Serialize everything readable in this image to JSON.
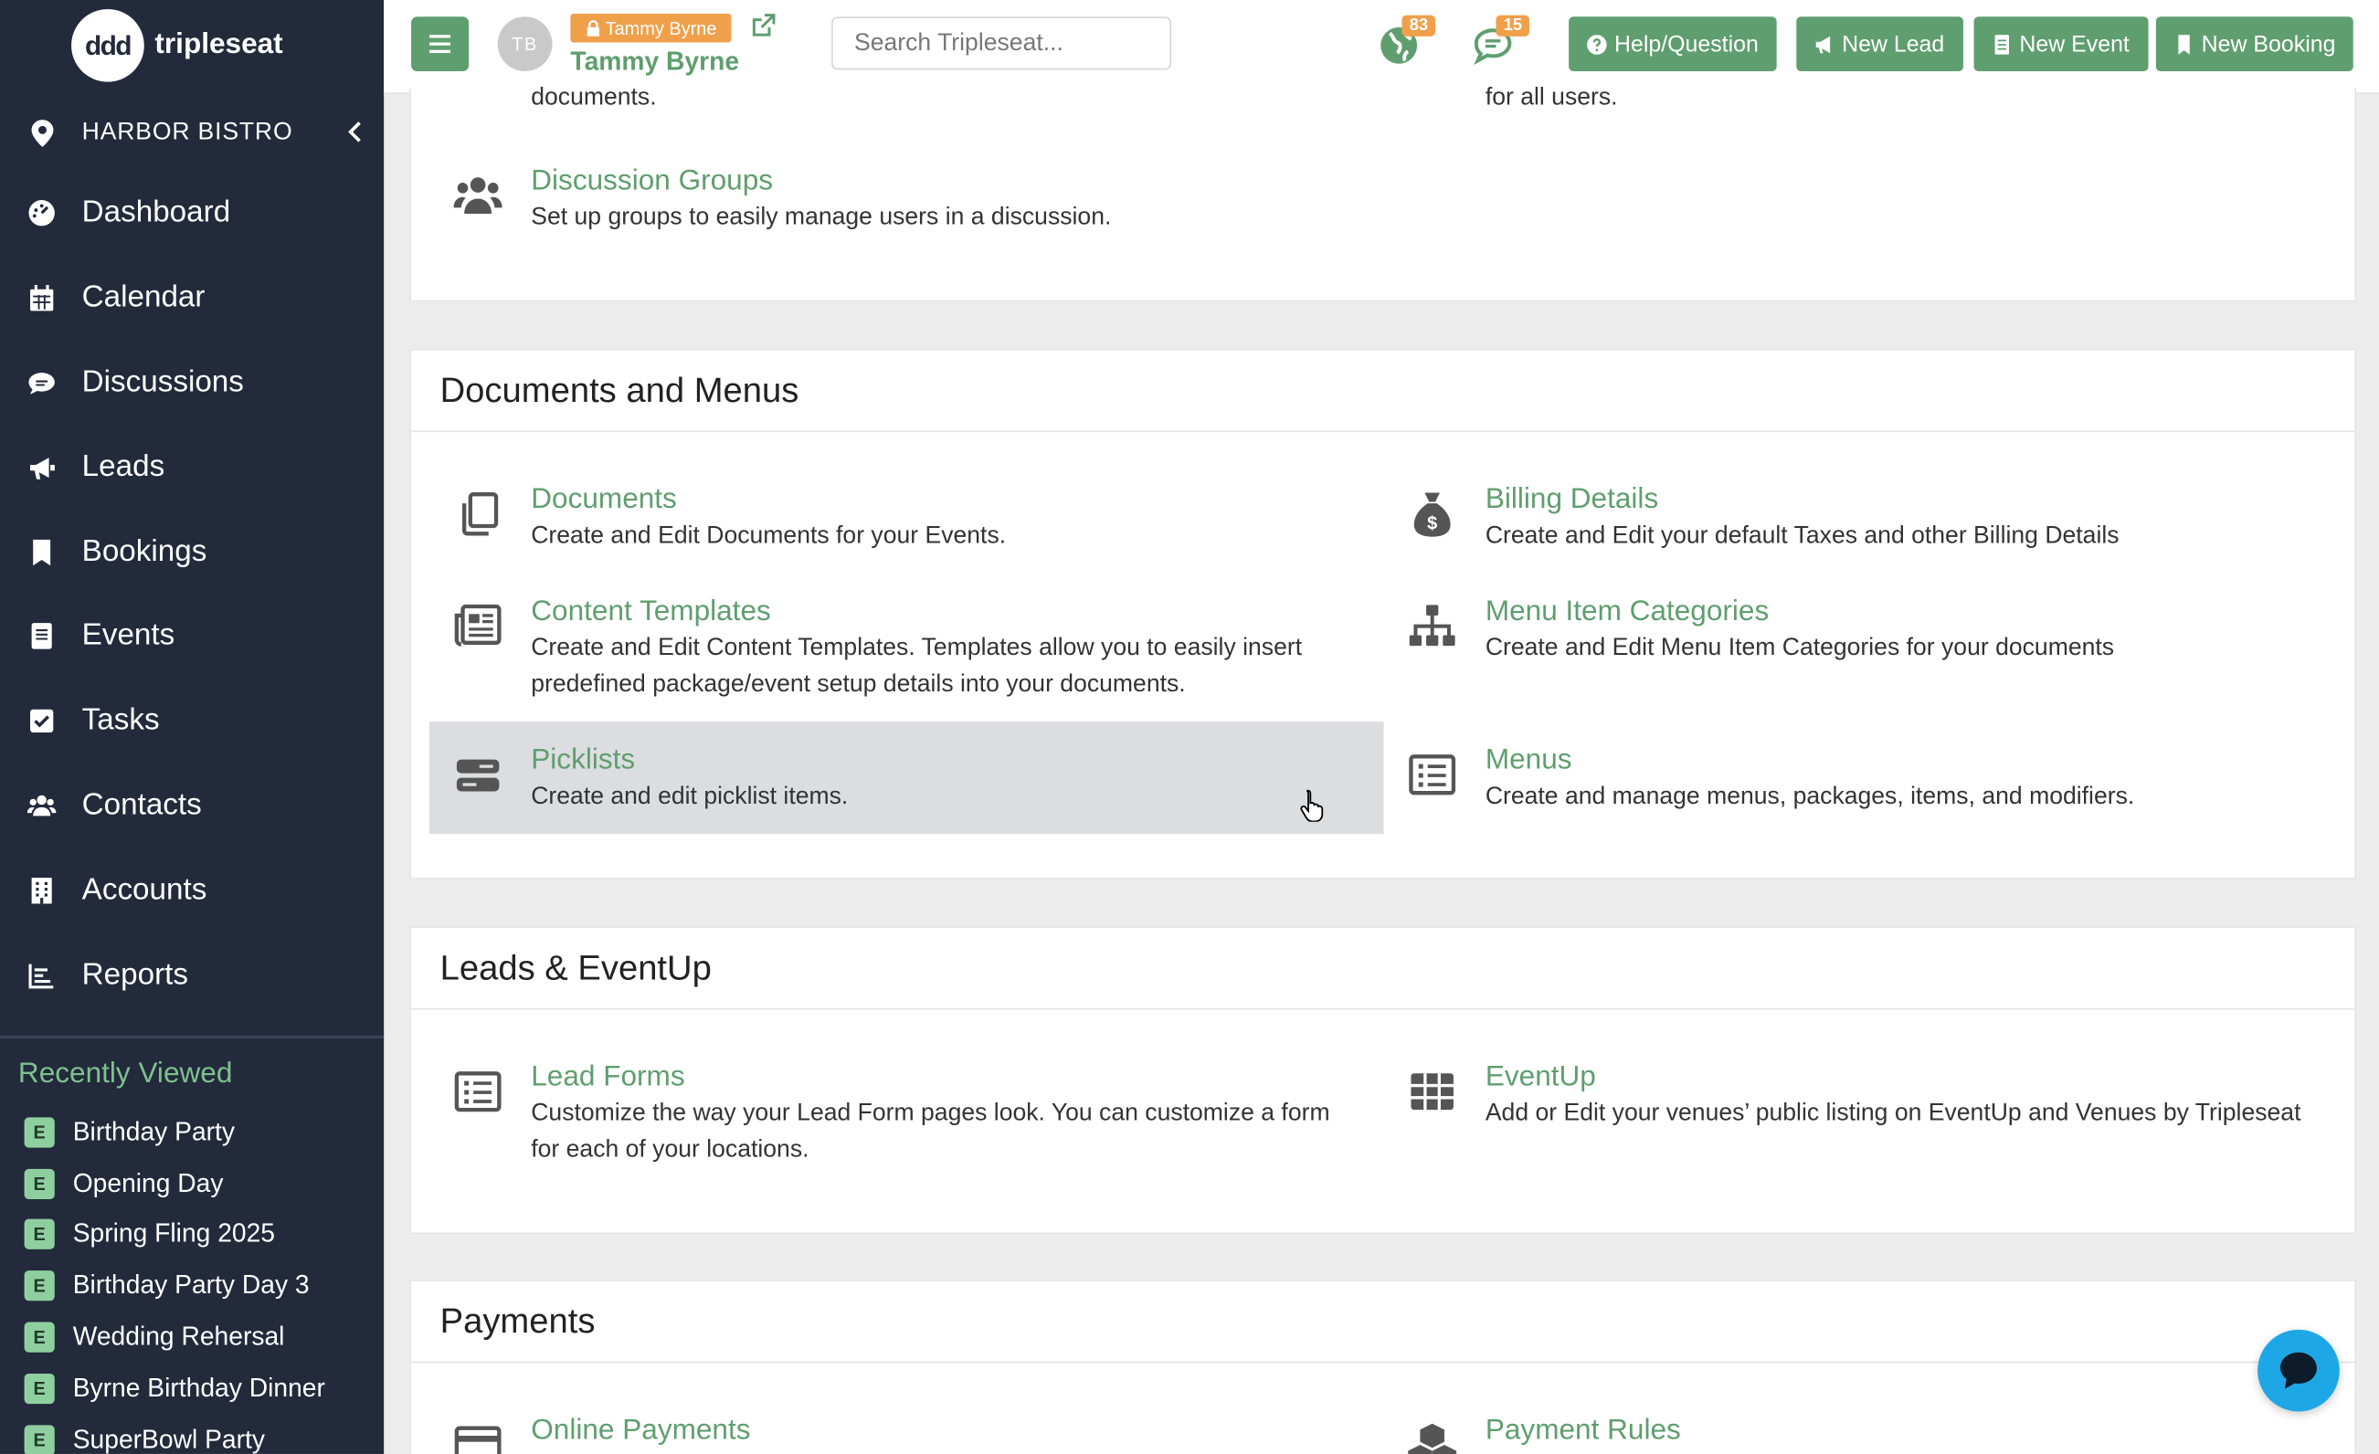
{
  "brand": {
    "logo_mark": "ddd",
    "name": "tripleseat"
  },
  "sidebar": {
    "location": "HARBOR BISTRO",
    "items": [
      {
        "label": "Dashboard",
        "icon": "dashboard-icon"
      },
      {
        "label": "Calendar",
        "icon": "calendar-icon"
      },
      {
        "label": "Discussions",
        "icon": "chat-icon"
      },
      {
        "label": "Leads",
        "icon": "megaphone-icon"
      },
      {
        "label": "Bookings",
        "icon": "bookmark-icon"
      },
      {
        "label": "Events",
        "icon": "event-icon"
      },
      {
        "label": "Tasks",
        "icon": "check-square-icon"
      },
      {
        "label": "Contacts",
        "icon": "users-icon"
      },
      {
        "label": "Accounts",
        "icon": "building-icon"
      },
      {
        "label": "Reports",
        "icon": "bar-chart-icon"
      }
    ],
    "recent_title": "Recently Viewed",
    "recent": [
      {
        "badge": "E",
        "label": "Birthday Party"
      },
      {
        "badge": "E",
        "label": "Opening Day"
      },
      {
        "badge": "E",
        "label": "Spring Fling 2025"
      },
      {
        "badge": "E",
        "label": "Birthday Party Day 3"
      },
      {
        "badge": "E",
        "label": "Wedding Rehersal"
      },
      {
        "badge": "E",
        "label": "Byrne Birthday Dinner"
      },
      {
        "badge": "E",
        "label": "SuperBowl Party"
      }
    ]
  },
  "topbar": {
    "avatar_initials": "TB",
    "user_tag": "Tammy Byrne",
    "user_name": "Tammy Byrne",
    "search_placeholder": "Search Tripleseat...",
    "notifications_count": "83",
    "messages_count": "15",
    "help_label": "Help/Question",
    "new_lead_label": "New Lead",
    "new_event_label": "New Event",
    "new_booking_label": "New Booking"
  },
  "sections": {
    "top_cut_left": "documents.",
    "top_cut_right": "for all users.",
    "discussion_groups": {
      "name": "Discussion Groups",
      "desc": "Set up groups to easily manage users in a discussion."
    },
    "documents_menus": {
      "title": "Documents and Menus",
      "documents": {
        "name": "Documents",
        "desc": "Create and Edit Documents for your Events."
      },
      "billing_details": {
        "name": "Billing Details",
        "desc": "Create and Edit your default Taxes and other Billing Details"
      },
      "content_templates": {
        "name": "Content Templates",
        "desc": "Create and Edit Content Templates. Templates allow you to easily insert predefined package/event setup details into your documents."
      },
      "menu_item_categories": {
        "name": "Menu Item Categories",
        "desc": "Create and Edit Menu Item Categories for your documents"
      },
      "picklists": {
        "name": "Picklists",
        "desc": "Create and edit picklist items."
      },
      "menus": {
        "name": "Menus",
        "desc": "Create and manage menus, packages, items, and modifiers."
      }
    },
    "leads_eventup": {
      "title": "Leads & EventUp",
      "lead_forms": {
        "name": "Lead Forms",
        "desc": "Customize the way your Lead Form pages look. You can customize a form for each of your locations."
      },
      "eventup": {
        "name": "EventUp",
        "desc": "Add or Edit your venues’ public listing on EventUp and Venues by Tripleseat"
      }
    },
    "payments": {
      "title": "Payments",
      "online_payments": {
        "name": "Online Payments"
      },
      "payment_rules": {
        "name": "Payment Rules"
      }
    }
  },
  "colors": {
    "accent": "#5f9e6e",
    "sidebar": "#222a3b",
    "badge": "#f0a04b",
    "chat": "#1ea7e6"
  }
}
